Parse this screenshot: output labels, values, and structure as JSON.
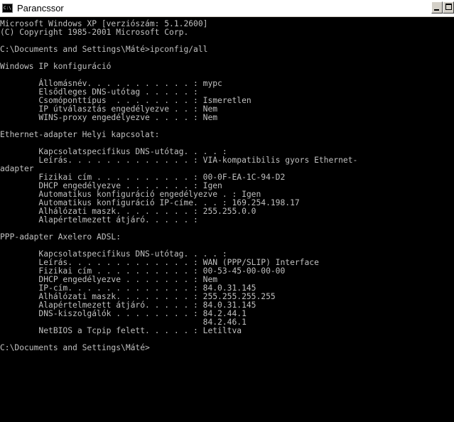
{
  "window": {
    "title": "Parancssor",
    "icon": "cmd-icon",
    "icon_glyph": "C:\\"
  },
  "console": {
    "lines": [
      "Microsoft Windows XP [verziószám: 5.1.2600]",
      "(C) Copyright 1985-2001 Microsoft Corp.",
      "",
      "C:\\Documents and Settings\\Máté>ipconfig/all",
      "",
      "Windows IP konfiguráció",
      "",
      "        Állomásnév. . . . . . . . . . . : mypc",
      "        Elsődleges DNS-utótag . . . . . :",
      "        Csomóponttípus  . . . . . . . . : Ismeretlen",
      "        IP útválasztás engedélyezve . . : Nem",
      "        WINS-proxy engedélyezve . . . . : Nem",
      "",
      "Ethernet-adapter Helyi kapcsolat:",
      "",
      "        Kapcsolatspecifikus DNS-utótag. . . . :",
      "        Leírás. . . . . . . . . . . . . : VIA-kompatibilis gyors Ethernet-",
      "adapter",
      "        Fizikai cím . . . . . . . . . . : 00-0F-EA-1C-94-D2",
      "        DHCP engedélyezve . . . . . . . : Igen",
      "        Automatikus konfiguráció engedélyezve . : Igen",
      "        Automatikus konfiguráció IP-címe. . . : 169.254.198.17",
      "        Alhálózati maszk. . . . . . . . : 255.255.0.0",
      "        Alapértelmezett átjáró. . . . . :",
      "",
      "PPP-adapter Axelero ADSL:",
      "",
      "        Kapcsolatspecifikus DNS-utótag. . . . :",
      "        Leírás. . . . . . . . . . . . . : WAN (PPP/SLIP) Interface",
      "        Fizikai cím . . . . . . . . . . : 00-53-45-00-00-00",
      "        DHCP engedélyezve . . . . . . . : Nem",
      "        IP-cím. . . . . . . . . . . . . : 84.0.31.145",
      "        Alhálózati maszk. . . . . . . . : 255.255.255.255",
      "        Alapértelmezett átjáró. . . . . : 84.0.31.145",
      "        DNS-kiszolgálók . . . . . . . . : 84.2.44.1",
      "                                          84.2.46.1",
      "        NetBIOS a Tcpip felett. . . . . : Letiltva",
      "",
      "C:\\Documents and Settings\\Máté>"
    ]
  },
  "colors": {
    "console_bg": "#000000",
    "console_text": "#c0c0c0",
    "titlebar_bg": "#ffffff"
  }
}
